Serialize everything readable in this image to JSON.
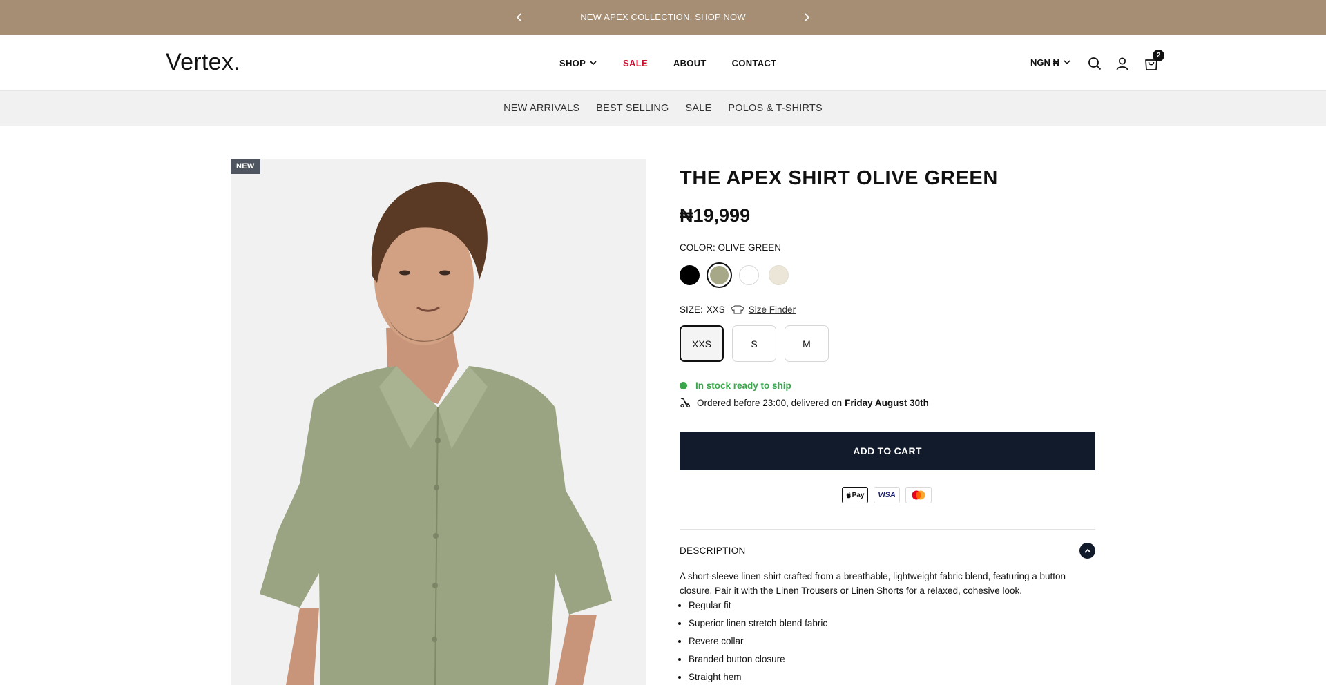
{
  "announcement": {
    "message": "NEW APEX COLLECTION.",
    "link": "SHOP NOW"
  },
  "header": {
    "logo": "Vertex.",
    "nav": {
      "shop": "SHOP",
      "sale": "SALE",
      "about": "ABOUT",
      "contact": "CONTACT"
    },
    "currency": "NGN ₦",
    "cart_count": "2"
  },
  "subnav": {
    "items": [
      "NEW ARRIVALS",
      "BEST SELLING",
      "SALE",
      "POLOS & T-SHIRTS"
    ]
  },
  "product": {
    "badge": "NEW",
    "title": "THE APEX SHIRT OLIVE GREEN",
    "price": "₦19,999",
    "color_label": "COLOR:",
    "color_value": "OLIVE GREEN",
    "swatches": [
      {
        "name": "black",
        "color": "#000000"
      },
      {
        "name": "olive-green",
        "color": "#a7a888",
        "selected": true
      },
      {
        "name": "white",
        "color": "#ffffff"
      },
      {
        "name": "beige",
        "color": "#ece6d9"
      }
    ],
    "size_label": "SIZE:",
    "size_value": "XXS",
    "size_finder": "Size Finder",
    "sizes": [
      "XXS",
      "S",
      "M"
    ],
    "selected_size": "XXS",
    "stock": "In stock ready to ship",
    "delivery_prefix": "Ordered before 23:00, delivered on",
    "delivery_date": "Friday August 30th",
    "add_to_cart": "ADD TO CART",
    "payments": [
      "Pay",
      "VISA"
    ],
    "description_heading": "DESCRIPTION",
    "description": "A short-sleeve linen shirt crafted from a breathable, lightweight fabric blend, featuring a button closure. Pair it with the Linen Trousers or Linen Shorts for a relaxed, cohesive look.",
    "features": [
      "Regular fit",
      "Superior linen stretch blend fabric",
      "Revere collar",
      "Branded button closure",
      "Straight hem"
    ]
  },
  "colors": {
    "announcement_bg": "#a58e73",
    "sale_red": "#c8102e",
    "button_navy": "#111b2c",
    "stock_green": "#3aa64b",
    "shirt_olive": "#9aa482"
  }
}
